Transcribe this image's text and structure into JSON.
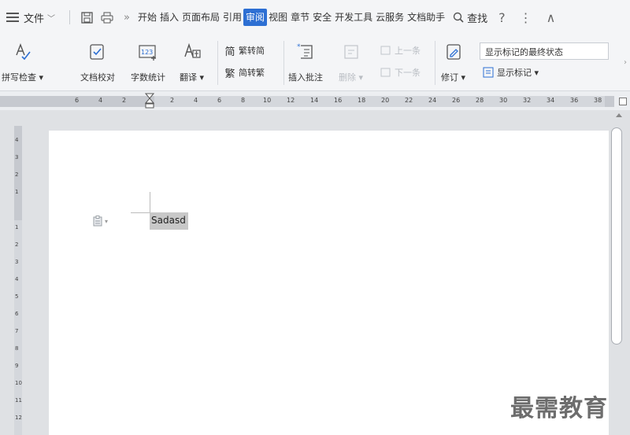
{
  "menubar": {
    "file_label": "文件",
    "tabs": [
      "开始",
      "插入",
      "页面布局",
      "引用",
      "审阅",
      "视图",
      "章节",
      "安全",
      "开发工具",
      "云服务",
      "文档助手"
    ],
    "active_tab_index": 4,
    "search_label": "查找",
    "help_icon": "?",
    "more_icon": "⋮",
    "collapse_icon": "∧"
  },
  "ribbon": {
    "spell_check": "拼写检查",
    "doc_proof": "文档校对",
    "word_count": "字数统计",
    "translate": "翻译",
    "trad_to_simp": "繁转简",
    "simp_to_trad": "简转繁",
    "insert_comment": "插入批注",
    "delete": "删除",
    "prev": "上一条",
    "next": "下一条",
    "track_changes": "修订",
    "markup_state": "显示标记的最终状态",
    "show_markup": "显示标记"
  },
  "ruler": {
    "labels": [
      "6",
      "4",
      "2",
      "2",
      "4",
      "6",
      "8",
      "10",
      "12",
      "14",
      "16",
      "18",
      "20",
      "22",
      "24",
      "26",
      "28",
      "30",
      "32",
      "34",
      "36",
      "38"
    ]
  },
  "vruler": {
    "labels": [
      "4",
      "3",
      "2",
      "1",
      "1",
      "2",
      "3",
      "4",
      "5",
      "6",
      "7",
      "8",
      "9",
      "10",
      "11",
      "12"
    ]
  },
  "document": {
    "selected_text": "Sadasd"
  },
  "watermark": "最需教育"
}
